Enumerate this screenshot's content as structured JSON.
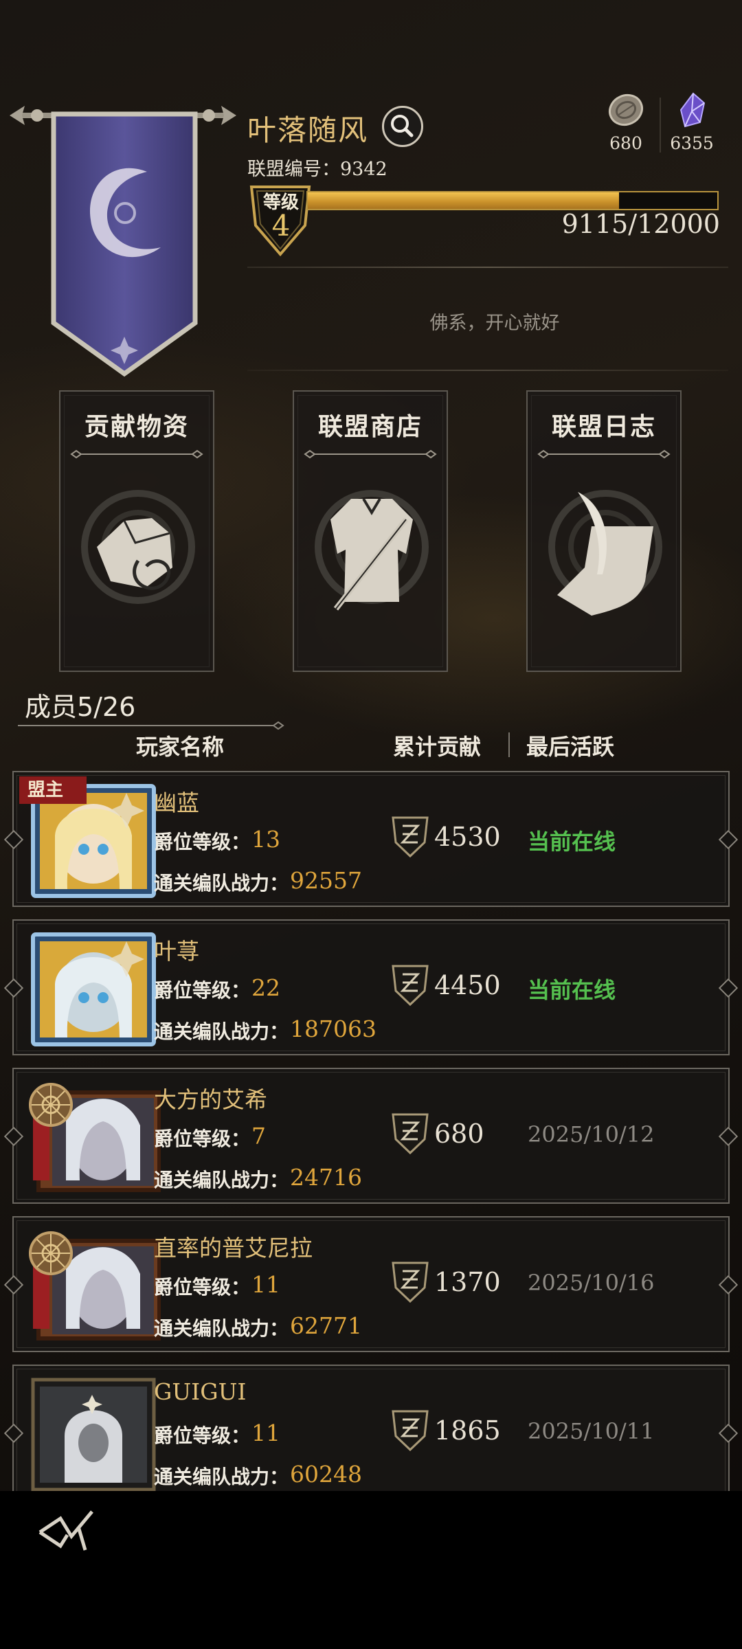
{
  "alliance": {
    "name": "叶落随风",
    "id_label": "联盟编号：",
    "id_value": "9342",
    "level_label": "等级",
    "level": "4",
    "xp_text": "9115/12000",
    "xp_fraction": 0.7596,
    "motto": "佛系，开心就好"
  },
  "currencies": [
    {
      "icon": "coin-icon",
      "value": "680"
    },
    {
      "icon": "purple-crystal-icon",
      "value": "6355"
    }
  ],
  "actions": [
    {
      "label": "贡献物资",
      "icon": "supplies-icon"
    },
    {
      "label": "联盟商店",
      "icon": "armor-shop-icon"
    },
    {
      "label": "联盟日志",
      "icon": "quill-scroll-icon"
    }
  ],
  "members": {
    "title": "成员5/26",
    "col_name": "玩家名称",
    "col_contrib": "累计贡献",
    "col_active": "最后活跃",
    "rank_label": "爵位等级：",
    "power_label": "通关编队战力：",
    "leader_tag": "盟主",
    "list": [
      {
        "name": "幽蓝",
        "rank": "13",
        "power": "92557",
        "contribution": "4530",
        "active": "当前在线",
        "online": true,
        "leader": true,
        "frame": "blue"
      },
      {
        "name": "叶荨",
        "rank": "22",
        "power": "187063",
        "contribution": "4450",
        "active": "当前在线",
        "online": true,
        "leader": false,
        "frame": "blue"
      },
      {
        "name": "大方的艾希",
        "rank": "7",
        "power": "24716",
        "contribution": "680",
        "active": "2025/10/12",
        "online": false,
        "leader": false,
        "frame": "scroll"
      },
      {
        "name": "直率的普艾尼拉",
        "rank": "11",
        "power": "62771",
        "contribution": "1370",
        "active": "2025/10/16",
        "online": false,
        "leader": false,
        "frame": "scroll"
      },
      {
        "name": "GUIGUI",
        "rank": "11",
        "power": "60248",
        "contribution": "1865",
        "active": "2025/10/11",
        "online": false,
        "leader": false,
        "frame": "plain"
      }
    ]
  },
  "colors": {
    "gold": "#e2c07a",
    "online": "#55c04f",
    "xp_fill": "#e0a63c"
  }
}
